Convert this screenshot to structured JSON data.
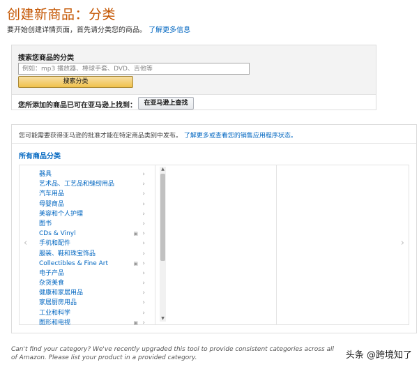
{
  "page": {
    "title": "创建新商品：分类",
    "intro_text": "要开始创建详情页面，首先请分类您的商品。",
    "intro_link": "了解更多信息"
  },
  "search": {
    "label": "搜索您商品的分类",
    "placeholder": "例如：mp3 播放器、棒球手套、DVD、吉他等",
    "button_label": "搜索分类",
    "check_label": "您所添加的商品已可在亚马逊上找到：",
    "check_button_label": "在亚马逊上查找"
  },
  "browse": {
    "approval_text": "您可能需要获得亚马逊的批准才能在特定商品类别中发布。",
    "approval_link": "了解更多或查看您的销售应用程序状态。",
    "all_categories_label": "所有商品分类",
    "categories": [
      {
        "label": "器具",
        "has_sub": false
      },
      {
        "label": "艺术品、工艺品和缝纫用品",
        "has_sub": false
      },
      {
        "label": "汽车用品",
        "has_sub": false
      },
      {
        "label": "母婴商品",
        "has_sub": false
      },
      {
        "label": "美容和个人护理",
        "has_sub": false
      },
      {
        "label": "图书",
        "has_sub": false
      },
      {
        "label": "CDs & Vinyl",
        "has_sub": true
      },
      {
        "label": "手机和配件",
        "has_sub": false
      },
      {
        "label": "服装、鞋和珠宝饰品",
        "has_sub": false
      },
      {
        "label": "Collectibles & Fine Art",
        "has_sub": true
      },
      {
        "label": "电子产品",
        "has_sub": false
      },
      {
        "label": "杂货美食",
        "has_sub": false
      },
      {
        "label": "健康和家居用品",
        "has_sub": false
      },
      {
        "label": "家居厨房用品",
        "has_sub": false
      },
      {
        "label": "工业和科学",
        "has_sub": false
      },
      {
        "label": "图形和电视",
        "has_sub": true
      }
    ]
  },
  "footer": {
    "note": "Can't find your category? We've recently upgraded this tool to provide consistent categories across all of Amazon. Please list your product in a provided category."
  },
  "watermark": "头条 @跨境知了",
  "icons": {
    "chevron": "chevron-right-icon",
    "arrow_left": "arrow-left-icon",
    "arrow_right": "arrow-right-icon"
  },
  "colors": {
    "title": "#c45500",
    "link": "#0066c0",
    "primary_button": "#f0c14b"
  }
}
